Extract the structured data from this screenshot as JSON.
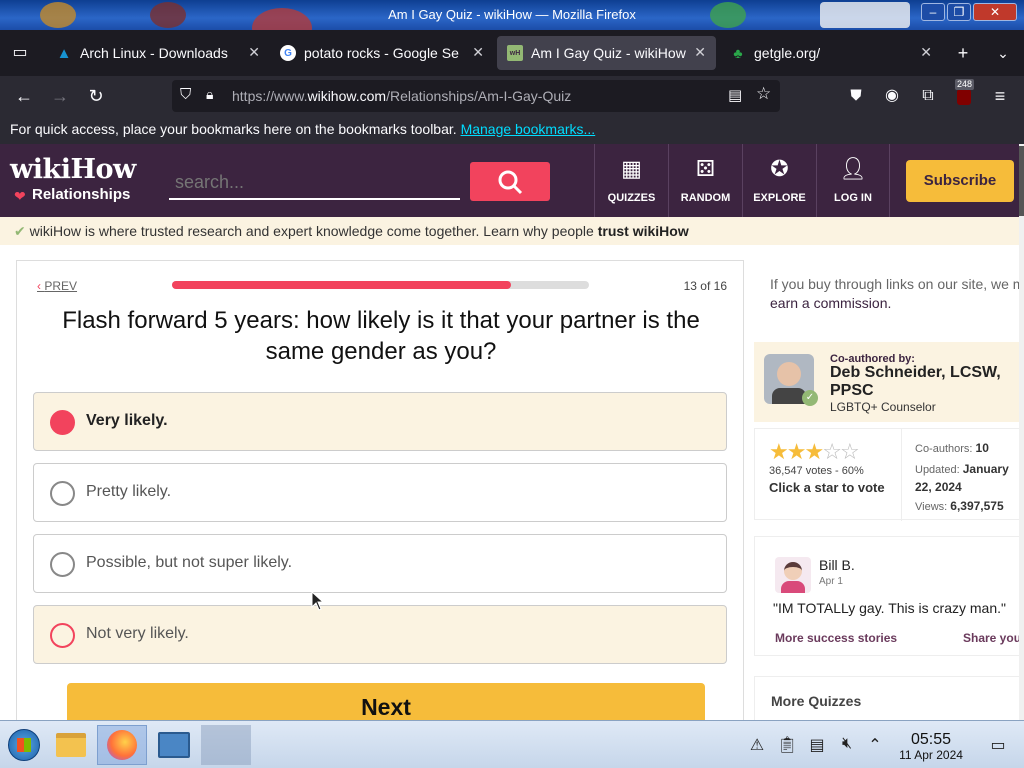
{
  "window": {
    "title": "Am I Gay Quiz - wikiHow — Mozilla Firefox"
  },
  "tabs": [
    {
      "label": "Arch Linux - Downloads",
      "favicon": "arch-icon",
      "color": "#1793d1",
      "active": false
    },
    {
      "label": "potato rocks - Google Se",
      "favicon": "google-icon",
      "color": "#4285f4",
      "active": false
    },
    {
      "label": "Am I Gay Quiz - wikiHow",
      "favicon": "wikihow-icon",
      "color": "#93b874",
      "active": true
    },
    {
      "label": "getgle.org/",
      "favicon": "getgle-icon",
      "color": "#2aa84a",
      "active": false
    }
  ],
  "navbar": {
    "url_prefix": "https://www.",
    "url_domain": "wikihow.com",
    "url_path": "/Relationships/Am-I-Gay-Quiz",
    "extension_badge": "248"
  },
  "bookmarks_bar": {
    "text": "For quick access, place your bookmarks here on the bookmarks toolbar.",
    "link": "Manage bookmarks..."
  },
  "header": {
    "logo": "wikiHow",
    "logo_sub": "Relationships",
    "search_placeholder": "search...",
    "nav": [
      {
        "label": "QUIZZES",
        "icon": "quizzes-icon"
      },
      {
        "label": "RANDOM",
        "icon": "dice-icon"
      },
      {
        "label": "EXPLORE",
        "icon": "compass-icon"
      },
      {
        "label": "LOG IN",
        "icon": "user-icon"
      }
    ],
    "subscribe": "Subscribe"
  },
  "trust_banner": {
    "text": "wikiHow is where trusted research and expert knowledge come together. Learn why people",
    "bold": "trust wikiHow"
  },
  "quiz": {
    "prev": "PREV",
    "progress": 0.8125,
    "counter": "13 of 16",
    "question": "Flash forward 5 years: how likely is it that your partner is the same gender as you?",
    "options": [
      {
        "label": "Very likely.",
        "selected": true
      },
      {
        "label": "Pretty likely.",
        "selected": false
      },
      {
        "label": "Possible, but not super likely.",
        "selected": false
      },
      {
        "label": "Not very likely.",
        "selected": false
      }
    ],
    "next": "Next"
  },
  "sidebar": {
    "affiliate_text": "If you buy through links on our site, we m",
    "affiliate_link": "earn a commission.",
    "coauthor_label": "Co-authored by:",
    "coauthor_name": "Deb Schneider, LCSW, PPSC",
    "coauthor_title": "LGBTQ+ Counselor",
    "rating": 3,
    "votes": "36,547 votes - 60%",
    "rate_prompt": "Click a star to vote",
    "coauthors_label": "Co-authors:",
    "coauthors_count": "10",
    "updated_label": "Updated:",
    "updated_value": "January 22, 2024",
    "views_label": "Views:",
    "views_value": "6,397,575",
    "story_author": "Bill B.",
    "story_date": "Apr 1",
    "story_text": "\"IM TOTALLy gay. This is crazy man.\"",
    "more_stories": "More success stories",
    "share_yours": "Share your",
    "more_quizzes": "More Quizzes"
  },
  "taskbar": {
    "time": "05:55",
    "date": "11 Apr 2024"
  }
}
